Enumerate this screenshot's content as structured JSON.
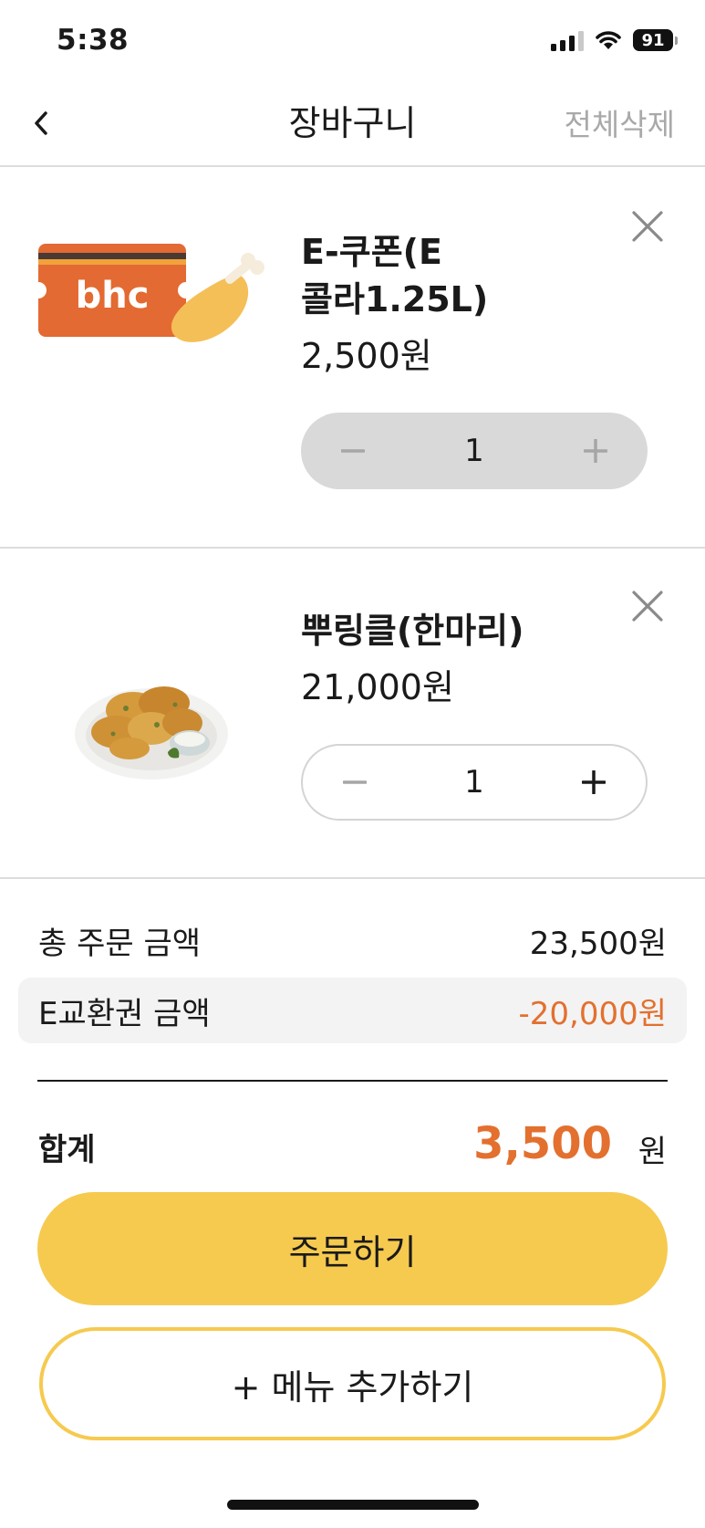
{
  "status_bar": {
    "time": "5:38",
    "battery": "91"
  },
  "header": {
    "title": "장바구니",
    "clear_all": "전체삭제"
  },
  "cart": {
    "items": [
      {
        "name": "E-쿠폰(E\n콜라1.25L)",
        "price": "2,500원",
        "quantity": "1",
        "image": "bhc-coupon-ticket-with-drumstick",
        "image_text": "bhc",
        "stepper_enabled": false
      },
      {
        "name": "뿌링클(한마리)",
        "price": "21,000원",
        "quantity": "1",
        "image": "seasoned-fried-chicken-plate",
        "stepper_enabled": true
      }
    ]
  },
  "summary": {
    "order_total_label": "총 주문 금액",
    "order_total_value": "23,500원",
    "voucher_label": "E교환권 금액",
    "voucher_value": "-20,000원",
    "total_label": "합계",
    "total_amount": "3,500",
    "total_unit": "원"
  },
  "actions": {
    "order": "주문하기",
    "add_menu": "+ 메뉴 추가하기"
  },
  "colors": {
    "accent": "#f6ca4f",
    "price_highlight": "#e3702f",
    "coupon_orange": "#e36a32"
  }
}
